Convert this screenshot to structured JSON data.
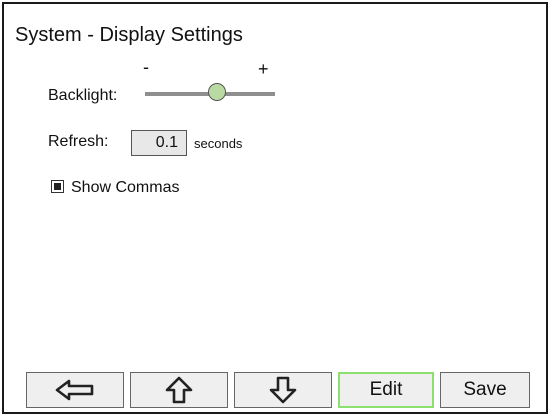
{
  "screen": {
    "title": "System - Display Settings"
  },
  "backlight": {
    "label": "Backlight:",
    "min_label": "-",
    "max_label": "+",
    "level": 0.55
  },
  "refresh": {
    "label": "Refresh:",
    "value": "0.1",
    "units": "seconds"
  },
  "show_commas": {
    "label": "Show Commas",
    "checked": true
  },
  "toolbar": {
    "back_icon": "left-arrow-icon",
    "up_icon": "up-arrow-icon",
    "down_icon": "down-arrow-icon",
    "edit_label": "Edit",
    "save_label": "Save",
    "edit_highlight_color": "#8be06e"
  },
  "colors": {
    "slider_knob": "#b9dba3",
    "slider_track": "#8f8f8f",
    "button_bg": "#efefef"
  }
}
